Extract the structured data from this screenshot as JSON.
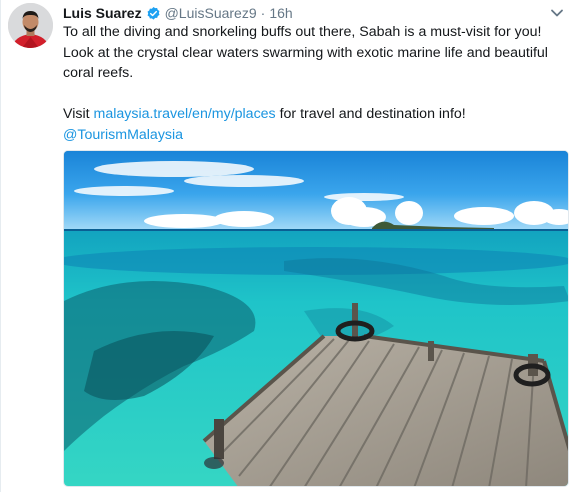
{
  "tweet": {
    "author_name": "Luis Suarez",
    "author_handle": "@LuisSuarez9",
    "separator": "·",
    "timestamp": "16h",
    "text_line_1": "To all the diving and snorkeling buffs out there, Sabah is a must-visit for you!",
    "text_line_2": "Look at the crystal clear waters swarming with exotic marine life and beautiful",
    "text_line_3": "coral reefs.",
    "visit_prefix": "Visit ",
    "visit_link": "malaysia.travel/en/my/places",
    "visit_suffix": " for travel and destination info!",
    "mention": "@TourismMalaysia"
  },
  "icons": {
    "verified": "verified-badge-icon",
    "caret": "chevron-down-icon"
  },
  "colors": {
    "link": "#1b95e0",
    "verified": "#1da1f2",
    "secondary_text": "#657786",
    "primary_text": "#14171a"
  }
}
